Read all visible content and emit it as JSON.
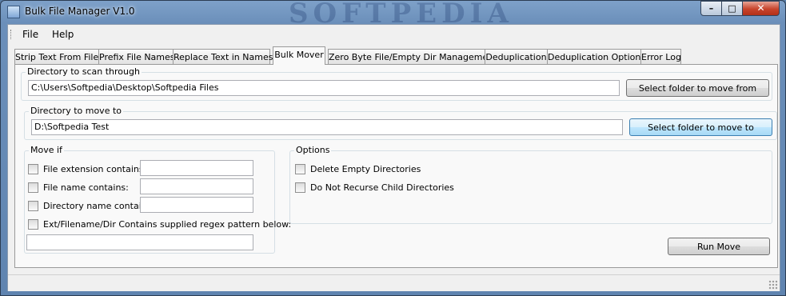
{
  "window": {
    "title": "Bulk File Manager V1.0",
    "watermark": "SOFTPEDIA",
    "controls": {
      "minimize": "–",
      "maximize": "□",
      "close": "✕"
    }
  },
  "menu": {
    "items": [
      "File",
      "Help"
    ]
  },
  "tabs": [
    "Strip Text From Files",
    "Prefix File Names",
    "Replace Text in Names",
    "Bulk Mover",
    "Zero Byte File/Empty Dir Management",
    "Deduplication",
    "Deduplication Options",
    "Error Log"
  ],
  "active_tab": "Bulk Mover",
  "scan_dir": {
    "label": "Directory to scan through",
    "value": "C:\\Users\\Softpedia\\Desktop\\Softpedia Files",
    "button": "Select folder to move from"
  },
  "move_dir": {
    "label": "Directory to move to",
    "value": "D:\\Softpedia Test",
    "button": "Select folder to move to"
  },
  "move_if": {
    "label": "Move if",
    "items": [
      {
        "label": "File extension contains:",
        "checked": false,
        "value": ""
      },
      {
        "label": "File name contains:",
        "checked": false,
        "value": ""
      },
      {
        "label": "Directory name contains:",
        "checked": false,
        "value": ""
      },
      {
        "label": "Ext/Filename/Dir Contains supplied regex pattern below:",
        "checked": false
      }
    ],
    "regex_value": ""
  },
  "options": {
    "label": "Options",
    "items": [
      {
        "label": "Delete Empty Directories",
        "checked": false
      },
      {
        "label": "Do Not Recurse Child Directories",
        "checked": false
      }
    ]
  },
  "run_button": "Run Move",
  "colors": {
    "accent_button": "#bee6fd",
    "close_button": "#c7432b",
    "titlebar": "#6b8fba"
  }
}
